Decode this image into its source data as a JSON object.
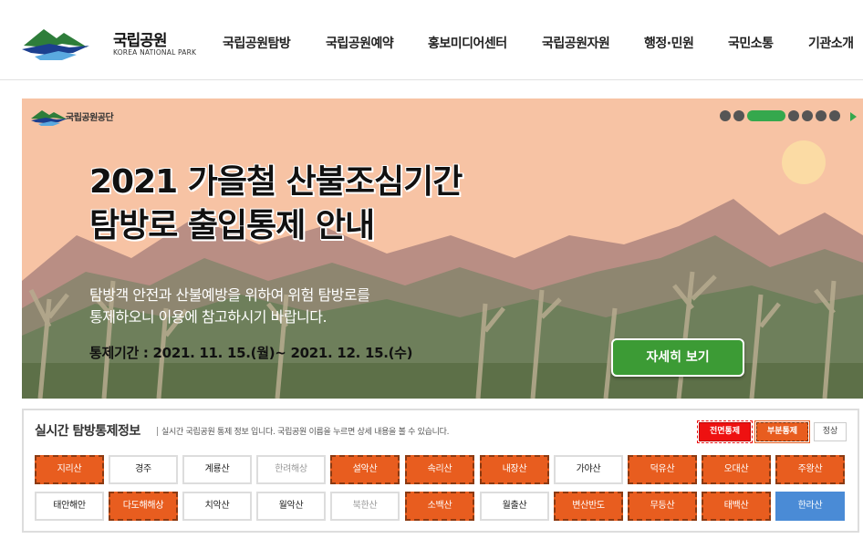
{
  "header": {
    "logo_ko": "국립공원",
    "logo_en": "KOREA NATIONAL PARK",
    "nav": [
      {
        "label": "국립공원탐방"
      },
      {
        "label": "국립공원예약"
      },
      {
        "label": "홍보미디어센터"
      },
      {
        "label": "국립공원자원"
      },
      {
        "label": "행정·민원"
      },
      {
        "label": "국민소통"
      },
      {
        "label": "기관소개"
      }
    ]
  },
  "banner": {
    "org": "국립공원공단",
    "title_line1": "2021 가을철 산불조심기간",
    "title_line2": "탐방로 출입통제 안내",
    "desc_line1": "탐방객 안전과 산불예방을 위하여 위험 탐방로를",
    "desc_line2": "통제하오니 이용에 참고하시기 바랍니다.",
    "period": "통제기간 : 2021. 11. 15.(월)~ 2021. 12. 15.(수)",
    "button": "자세히 보기",
    "slide_count": 8,
    "active_slide": 3,
    "colors": {
      "sky": "#f7c3a4",
      "accent": "#35a84d"
    }
  },
  "realtime": {
    "title": "실시간 탐방통제정보",
    "desc": "실시간 국립공원 통제 정보 입니다. 국립공원 이름을 누르면 상세 내용을 볼 수 있습니다.",
    "legend": {
      "full": "전면통제",
      "partial": "부분통제",
      "normal": "정상"
    },
    "colors": {
      "full": "#e11111",
      "partial": "#e85d1f",
      "open_blue": "#4a8bd6"
    },
    "row1": [
      {
        "name": "지리산",
        "status": "partial"
      },
      {
        "name": "경주",
        "status": "normal"
      },
      {
        "name": "계룡산",
        "status": "normal"
      },
      {
        "name": "한려해상",
        "status": "normal-gray"
      },
      {
        "name": "설악산",
        "status": "partial"
      },
      {
        "name": "속리산",
        "status": "partial"
      },
      {
        "name": "내장산",
        "status": "partial"
      },
      {
        "name": "가야산",
        "status": "normal"
      },
      {
        "name": "덕유산",
        "status": "partial"
      },
      {
        "name": "오대산",
        "status": "partial"
      },
      {
        "name": "주왕산",
        "status": "partial"
      }
    ],
    "row2": [
      {
        "name": "태안해안",
        "status": "normal"
      },
      {
        "name": "다도해해상",
        "status": "partial"
      },
      {
        "name": "치악산",
        "status": "normal"
      },
      {
        "name": "월악산",
        "status": "normal"
      },
      {
        "name": "북한산",
        "status": "normal-gray"
      },
      {
        "name": "소백산",
        "status": "partial"
      },
      {
        "name": "월출산",
        "status": "normal"
      },
      {
        "name": "변산반도",
        "status": "partial"
      },
      {
        "name": "무등산",
        "status": "partial"
      },
      {
        "name": "태백산",
        "status": "partial"
      },
      {
        "name": "한라산",
        "status": "blue"
      }
    ]
  }
}
